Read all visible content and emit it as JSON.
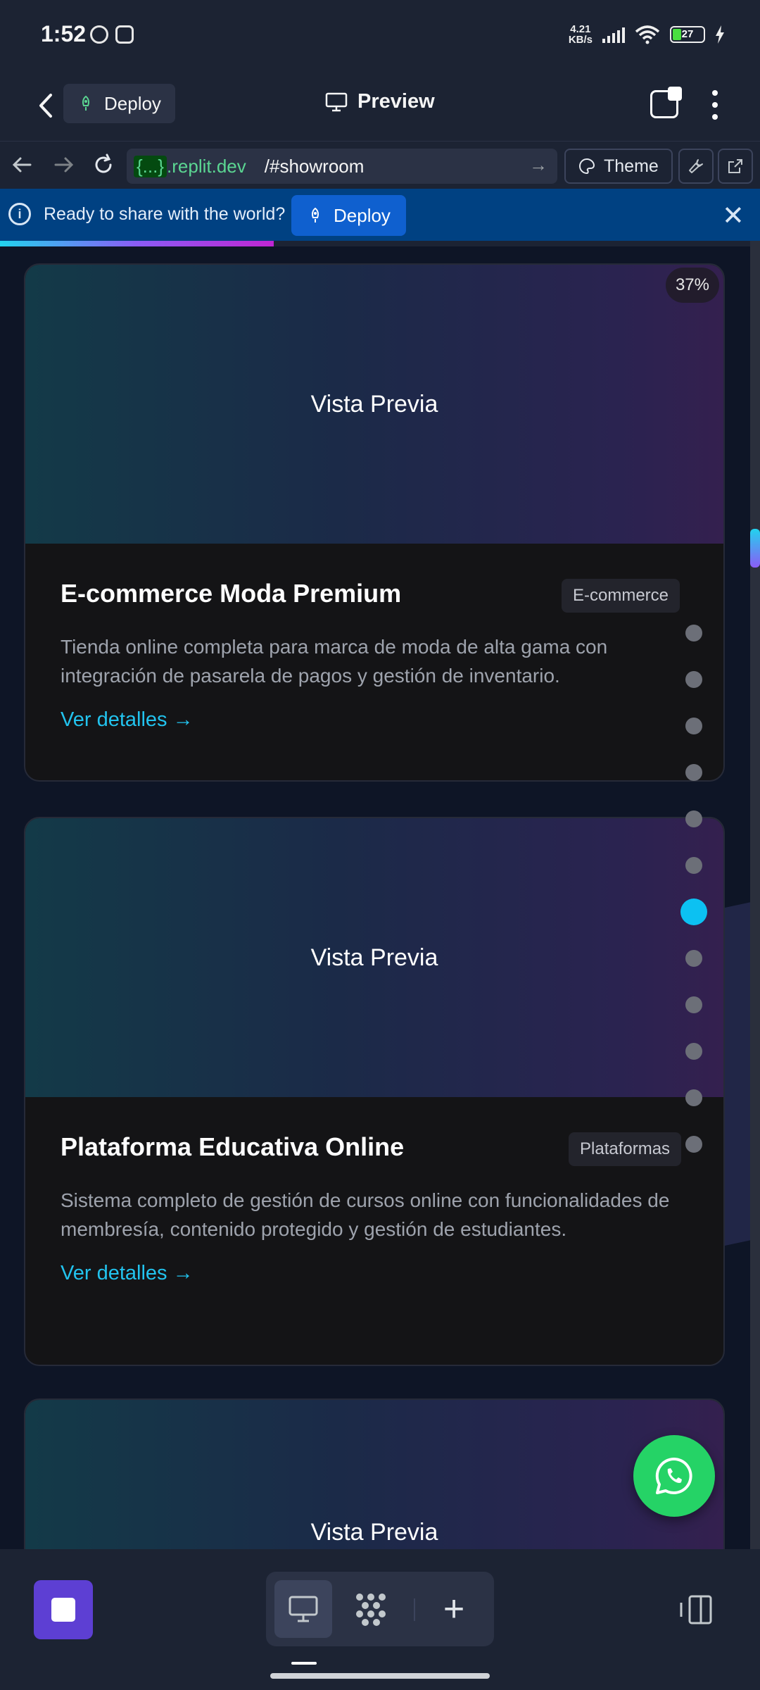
{
  "status_bar": {
    "time": "1:52",
    "net_speed_value": "4.21",
    "net_speed_unit": "KB/s",
    "battery": "27"
  },
  "header": {
    "back_label": "‹",
    "deploy_label": "Deploy",
    "title": "Preview"
  },
  "url_bar": {
    "braces": "{...}",
    "host": ".replit.dev",
    "path": "/#showroom",
    "theme_label": "Theme"
  },
  "banner": {
    "message": "Ready to share with the world?",
    "deploy_label": "Deploy"
  },
  "page": {
    "progress_percent": 36,
    "scroll_position_percent": 22,
    "scroll_thumb_percent": 3,
    "dots_count": 12,
    "active_dot_index": 6,
    "cards": [
      {
        "preview_label": "Vista Previa",
        "badge": "37%",
        "title": "E-commerce Moda Premium",
        "tag": "E-commerce",
        "description": "Tienda online completa para marca de moda de alta gama con integración de pasarela de pagos y gestión de inventario.",
        "link": "Ver detalles →"
      },
      {
        "preview_label": "Vista Previa",
        "title": "Plataforma Educativa Online",
        "tag": "Plataformas",
        "description": "Sistema completo de gestión de cursos online con funcionalidades de membresía, contenido protegido y gestión de estudiantes.",
        "link": "Ver detalles →"
      },
      {
        "preview_label": "Vista Previa"
      }
    ]
  },
  "colors": {
    "accent": "#22c3ee",
    "deploy_blue": "#0f60cf",
    "stop_purple": "#5d3fd3",
    "whatsapp_green": "#25d366"
  },
  "icons": [
    "back-arrow-icon",
    "rocket-icon",
    "monitor-icon",
    "tabs-icon",
    "more-vertical-icon",
    "reload-icon",
    "palette-icon",
    "wrench-icon",
    "external-link-icon",
    "info-icon",
    "close-icon",
    "whatsapp-icon",
    "stop-icon",
    "grid-dots-icon",
    "plus-icon",
    "panel-icon"
  ]
}
